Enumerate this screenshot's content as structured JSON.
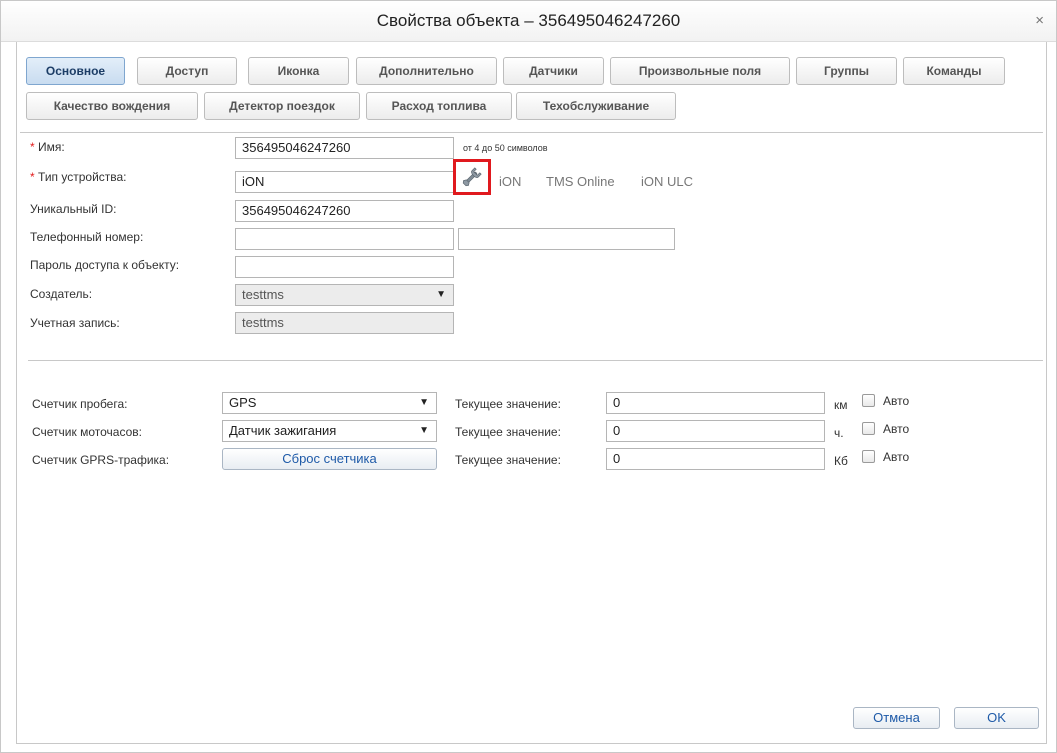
{
  "window": {
    "title": "Свойства объекта – 356495046247260",
    "close_glyph": "×"
  },
  "tabs_row1": [
    "Основное",
    "Доступ",
    "Иконка",
    "Дополнительно",
    "Датчики",
    "Произвольные поля",
    "Группы",
    "Команды"
  ],
  "tabs_row2": [
    "Качество вождения",
    "Детектор поездок",
    "Расход топлива",
    "Техобслуживание"
  ],
  "active_tab": "Основное",
  "form": {
    "required_mark": "*",
    "name_label": "Имя:",
    "name_value": "356495046247260",
    "name_hint": "от 4 до 50 символов",
    "device_type_label": "Тип устройства:",
    "device_type_value": "iON",
    "device_type_shortcuts": [
      "iON",
      "TMS Online",
      "iON ULC"
    ],
    "unique_id_label": "Уникальный ID:",
    "unique_id_value": "356495046247260",
    "phone_label": "Телефонный номер:",
    "phone_value": "",
    "phone_value_2": "",
    "password_label": "Пароль доступа к объекту:",
    "password_value": "",
    "creator_label": "Создатель:",
    "creator_value": "testtms",
    "account_label": "Учетная запись:",
    "account_value": "testtms"
  },
  "counters": {
    "current_value_label": "Текущее значение:",
    "auto_label": "Авто",
    "mileage_label": "Счетчик пробега:",
    "mileage_source": "GPS",
    "mileage_value": "0",
    "mileage_unit": "км",
    "motohours_label": "Счетчик моточасов:",
    "motohours_source": "Датчик зажигания",
    "motohours_value": "0",
    "motohours_unit": "ч.",
    "gprs_label": "Счетчик GPRS-трафика:",
    "gprs_reset_button": "Сброс счетчика",
    "gprs_value": "0",
    "gprs_unit": "Кб"
  },
  "footer": {
    "cancel_label": "Отмена",
    "ok_label": "OK"
  },
  "icons": {
    "wrench": "wrench-icon",
    "dropdown": "dropdown-arrow-icon",
    "close": "close-icon"
  },
  "colors": {
    "active_tab_bg": "#c9dcf0",
    "required_mark": "#e21b1b",
    "highlight_box": "#e0191e",
    "link_blue": "#1e5aa8"
  }
}
